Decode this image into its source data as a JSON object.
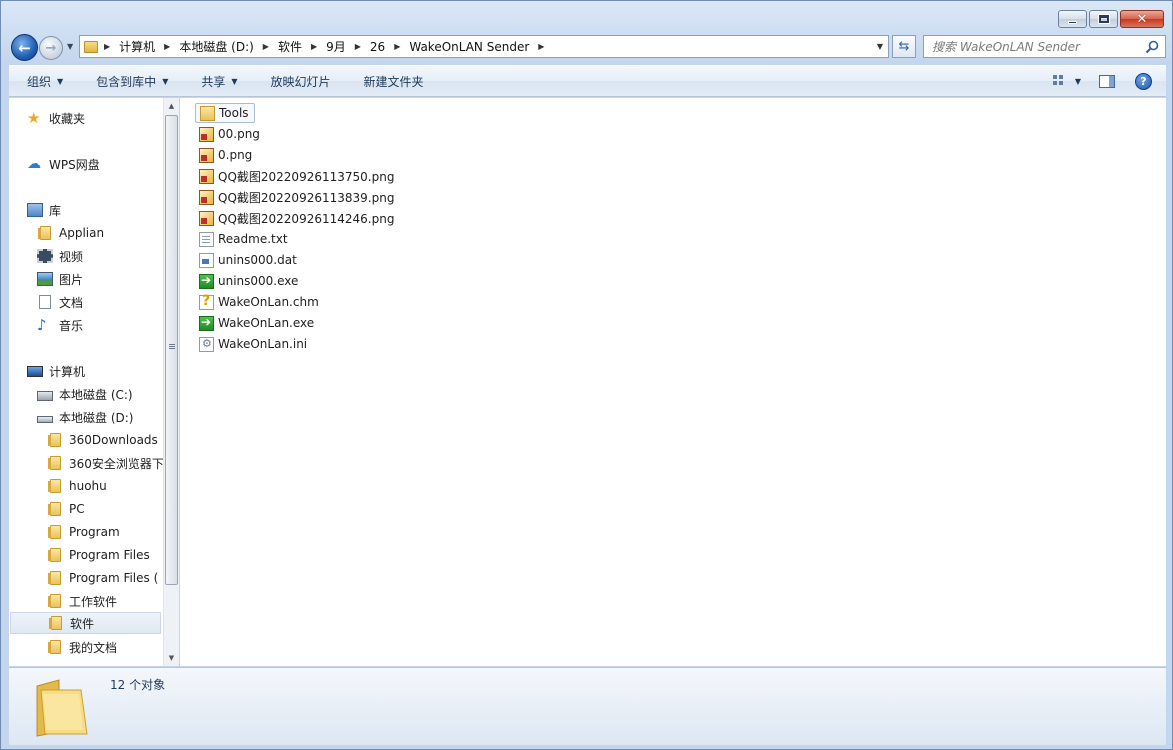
{
  "window": {
    "caption_buttons": {
      "minimize": "minimize",
      "maximize": "maximize",
      "close": "✕"
    }
  },
  "nav": {
    "back_glyph": "←",
    "forward_glyph": "→",
    "address": {
      "crumbs": [
        "计算机",
        "本地磁盘 (D:)",
        "软件",
        "9月",
        "26",
        "WakeOnLAN Sender"
      ]
    },
    "search_placeholder": "搜索 WakeOnLAN Sender"
  },
  "toolbar": {
    "organize": "组织",
    "include_library": "包含到库中",
    "share": "共享",
    "slideshow": "放映幻灯片",
    "new_folder": "新建文件夹",
    "help": "?"
  },
  "sidebar": {
    "favorites": "收藏夹",
    "wps": "WPS网盘",
    "libraries": "库",
    "library_items": [
      "Applian",
      "视频",
      "图片",
      "文档",
      "音乐"
    ],
    "computer": "计算机",
    "drives": [
      "本地磁盘 (C:)",
      "本地磁盘 (D:)"
    ],
    "d_folders": [
      "360Downloads",
      "360安全浏览器下",
      "huohu",
      "PC",
      "Program",
      "Program Files",
      "Program Files (",
      "工作软件",
      "软件",
      "我的文档"
    ],
    "selected": "软件"
  },
  "files": [
    {
      "name": "Tools",
      "icon": "folder-icon"
    },
    {
      "name": "00.png",
      "icon": "image-file-icon"
    },
    {
      "name": "0.png",
      "icon": "image-file-icon"
    },
    {
      "name": "QQ截图20220926113750.png",
      "icon": "image-file-icon"
    },
    {
      "name": "QQ截图20220926113839.png",
      "icon": "image-file-icon"
    },
    {
      "name": "QQ截图20220926114246.png",
      "icon": "image-file-icon"
    },
    {
      "name": "Readme.txt",
      "icon": "text-file-icon"
    },
    {
      "name": "unins000.dat",
      "icon": "dat-file-icon"
    },
    {
      "name": "unins000.exe",
      "icon": "exe-file-icon"
    },
    {
      "name": "WakeOnLan.chm",
      "icon": "help-file-icon"
    },
    {
      "name": "WakeOnLan.exe",
      "icon": "exe-file-icon"
    },
    {
      "name": "WakeOnLan.ini",
      "icon": "settings-file-icon"
    }
  ],
  "status": {
    "count_text": "12 个对象"
  }
}
